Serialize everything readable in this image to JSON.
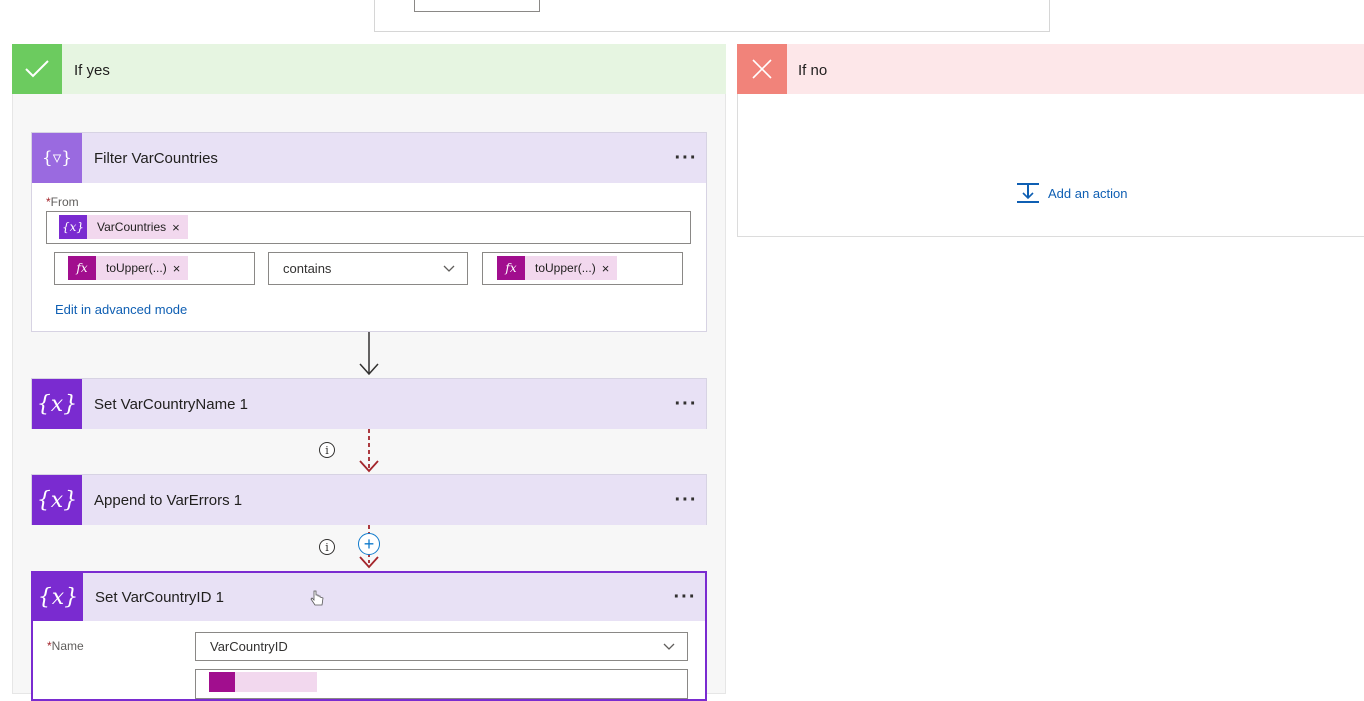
{
  "branches": {
    "yes": {
      "title": "If yes",
      "color": "#6ccb5f"
    },
    "no": {
      "title": "If no",
      "color": "#f1837a",
      "add_action_label": "Add an action"
    }
  },
  "filter_card": {
    "title": "Filter VarCountries",
    "from_label": "From",
    "from_token": "VarCountries",
    "left_token": "toUpper(...)",
    "operator": "contains",
    "right_token": "toUpper(...)",
    "advanced_link": "Edit in advanced mode"
  },
  "set_name_card": {
    "title": "Set VarCountryName 1"
  },
  "append_card": {
    "title": "Append to VarErrors 1"
  },
  "set_id_card": {
    "title": "Set VarCountryID 1",
    "name_label": "Name",
    "name_value": "VarCountryID"
  },
  "icons": {
    "variable": "{x}",
    "filter": "{▿}",
    "expression": "fx",
    "token_close": "×",
    "more": "···",
    "info": "i",
    "plus": "+"
  }
}
